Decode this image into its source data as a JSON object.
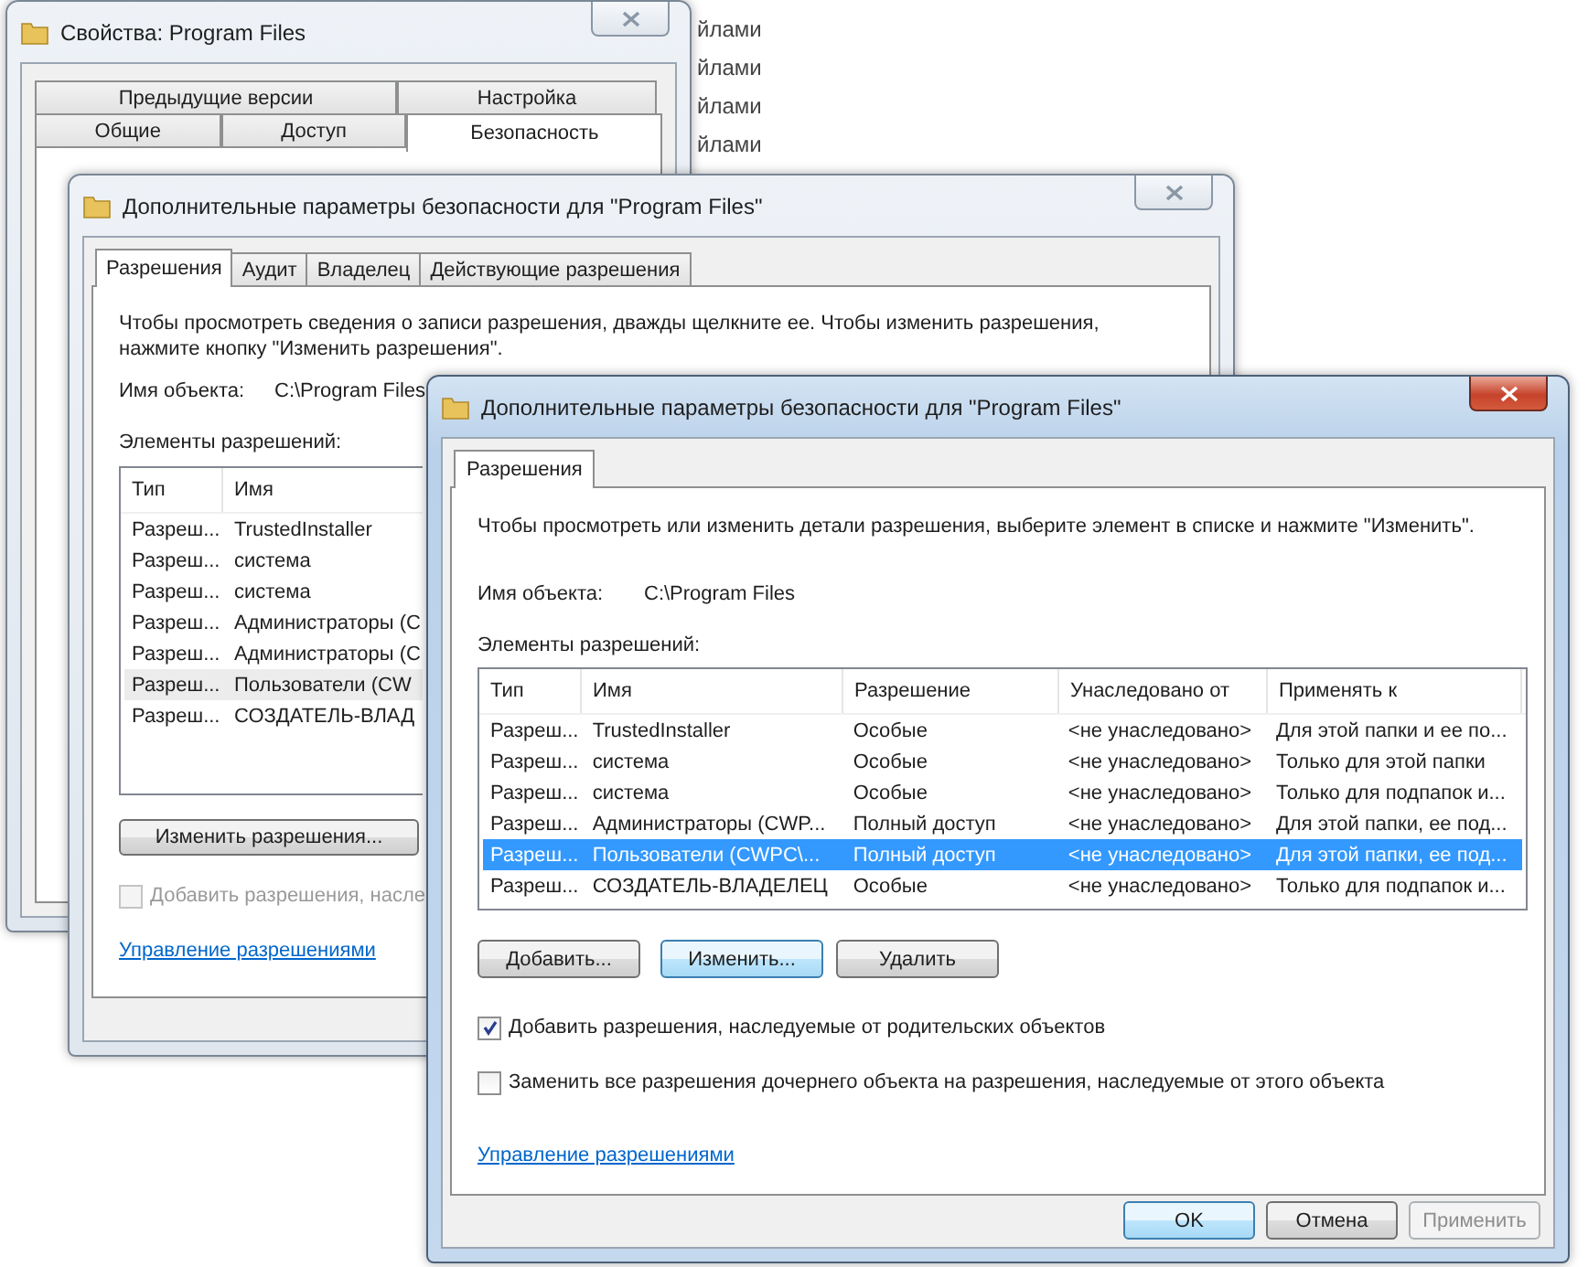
{
  "background": {
    "items": [
      "йлами",
      "йлами",
      "йлами",
      "йлами"
    ]
  },
  "properties_window": {
    "title": "Свойства: Program Files",
    "active": false,
    "tab_rows": [
      {
        "tabs": [
          {
            "label": "Предыдущие версии",
            "selected": false
          },
          {
            "label": "Настройка",
            "selected": false
          }
        ]
      },
      {
        "tabs": [
          {
            "label": "Общие",
            "selected": false
          },
          {
            "label": "Доступ",
            "selected": false
          },
          {
            "label": "Безопасность",
            "selected": true
          }
        ]
      }
    ]
  },
  "advanced_window": {
    "title": "Дополнительные параметры безопасности  для \"Program Files\"",
    "active": false,
    "tabs": [
      {
        "label": "Разрешения",
        "selected": true
      },
      {
        "label": "Аудит",
        "selected": false
      },
      {
        "label": "Владелец",
        "selected": false
      },
      {
        "label": "Действующие разрешения",
        "selected": false
      }
    ],
    "instructions": [
      "Чтобы просмотреть сведения о записи разрешения, дважды щелкните ее. Чтобы изменить разрешения,",
      "нажмите кнопку \"Изменить разрешения\"."
    ],
    "object_label": "Имя объекта:",
    "object_value": "C:\\Program Files",
    "list_label": "Элементы разрешений:",
    "columns": [
      "Тип",
      "Имя"
    ],
    "rows": [
      {
        "cells": [
          "Разреш...",
          "TrustedInstaller"
        ],
        "selected": false
      },
      {
        "cells": [
          "Разреш...",
          "система"
        ],
        "selected": false
      },
      {
        "cells": [
          "Разреш...",
          "система"
        ],
        "selected": false
      },
      {
        "cells": [
          "Разреш...",
          "Администраторы (C"
        ],
        "selected": false
      },
      {
        "cells": [
          "Разреш...",
          "Администраторы (C"
        ],
        "selected": false
      },
      {
        "cells": [
          "Разреш...",
          "Пользователи (CW"
        ],
        "selected": true
      },
      {
        "cells": [
          "Разреш...",
          "СОЗДАТЕЛЬ-ВЛАД"
        ],
        "selected": false
      }
    ],
    "edit_button": "Изменить разрешения...",
    "checkbox": {
      "label": "Добавить разрешения, насле",
      "checked": false,
      "disabled": true
    },
    "link": "Управление разрешениями"
  },
  "edit_window": {
    "title": "Дополнительные параметры безопасности  для \"Program Files\"",
    "active": true,
    "tabs": [
      {
        "label": "Разрешения",
        "selected": true
      }
    ],
    "instructions": "Чтобы просмотреть или изменить детали разрешения, выберите элемент в списке и нажмите \"Изменить\".",
    "object_label": "Имя объекта:",
    "object_value": "C:\\Program Files",
    "list_label": "Элементы разрешений:",
    "columns": [
      "Тип",
      "Имя",
      "Разрешение",
      "Унаследовано от",
      "Применять к"
    ],
    "rows": [
      {
        "cells": [
          "Разреш...",
          "TrustedInstaller",
          "Особые",
          "<не унаследовано>",
          "Для этой папки и ее по..."
        ],
        "selected": false
      },
      {
        "cells": [
          "Разреш...",
          "система",
          "Особые",
          "<не унаследовано>",
          "Только для этой папки"
        ],
        "selected": false
      },
      {
        "cells": [
          "Разреш...",
          "система",
          "Особые",
          "<не унаследовано>",
          "Только для подпапок и..."
        ],
        "selected": false
      },
      {
        "cells": [
          "Разреш...",
          "Администраторы (CWP...",
          "Полный доступ",
          "<не унаследовано>",
          "Для этой папки, ее под..."
        ],
        "selected": false
      },
      {
        "cells": [
          "Разреш...",
          "Пользователи (CWPC\\...",
          "Полный доступ",
          "<не унаследовано>",
          "Для этой папки, ее под..."
        ],
        "selected": true
      },
      {
        "cells": [
          "Разреш...",
          "СОЗДАТЕЛЬ-ВЛАДЕЛЕЦ",
          "Особые",
          "<не унаследовано>",
          "Только для подпапок и..."
        ],
        "selected": false
      }
    ],
    "buttons": [
      {
        "label": "Добавить...",
        "focused": false
      },
      {
        "label": "Изменить...",
        "focused": true
      },
      {
        "label": "Удалить",
        "focused": false
      }
    ],
    "checkboxes": [
      {
        "label": "Добавить разрешения, наследуемые от родительских объектов",
        "checked": true,
        "disabled": false
      },
      {
        "label": "Заменить все разрешения дочернего объекта на разрешения, наследуемые от этого объекта",
        "checked": false,
        "disabled": false
      }
    ],
    "link": "Управление разрешениями",
    "footer_buttons": [
      {
        "label": "OK",
        "default": true,
        "disabled": false
      },
      {
        "label": "Отмена",
        "default": false,
        "disabled": false
      },
      {
        "label": "Применить",
        "default": false,
        "disabled": true
      }
    ]
  }
}
